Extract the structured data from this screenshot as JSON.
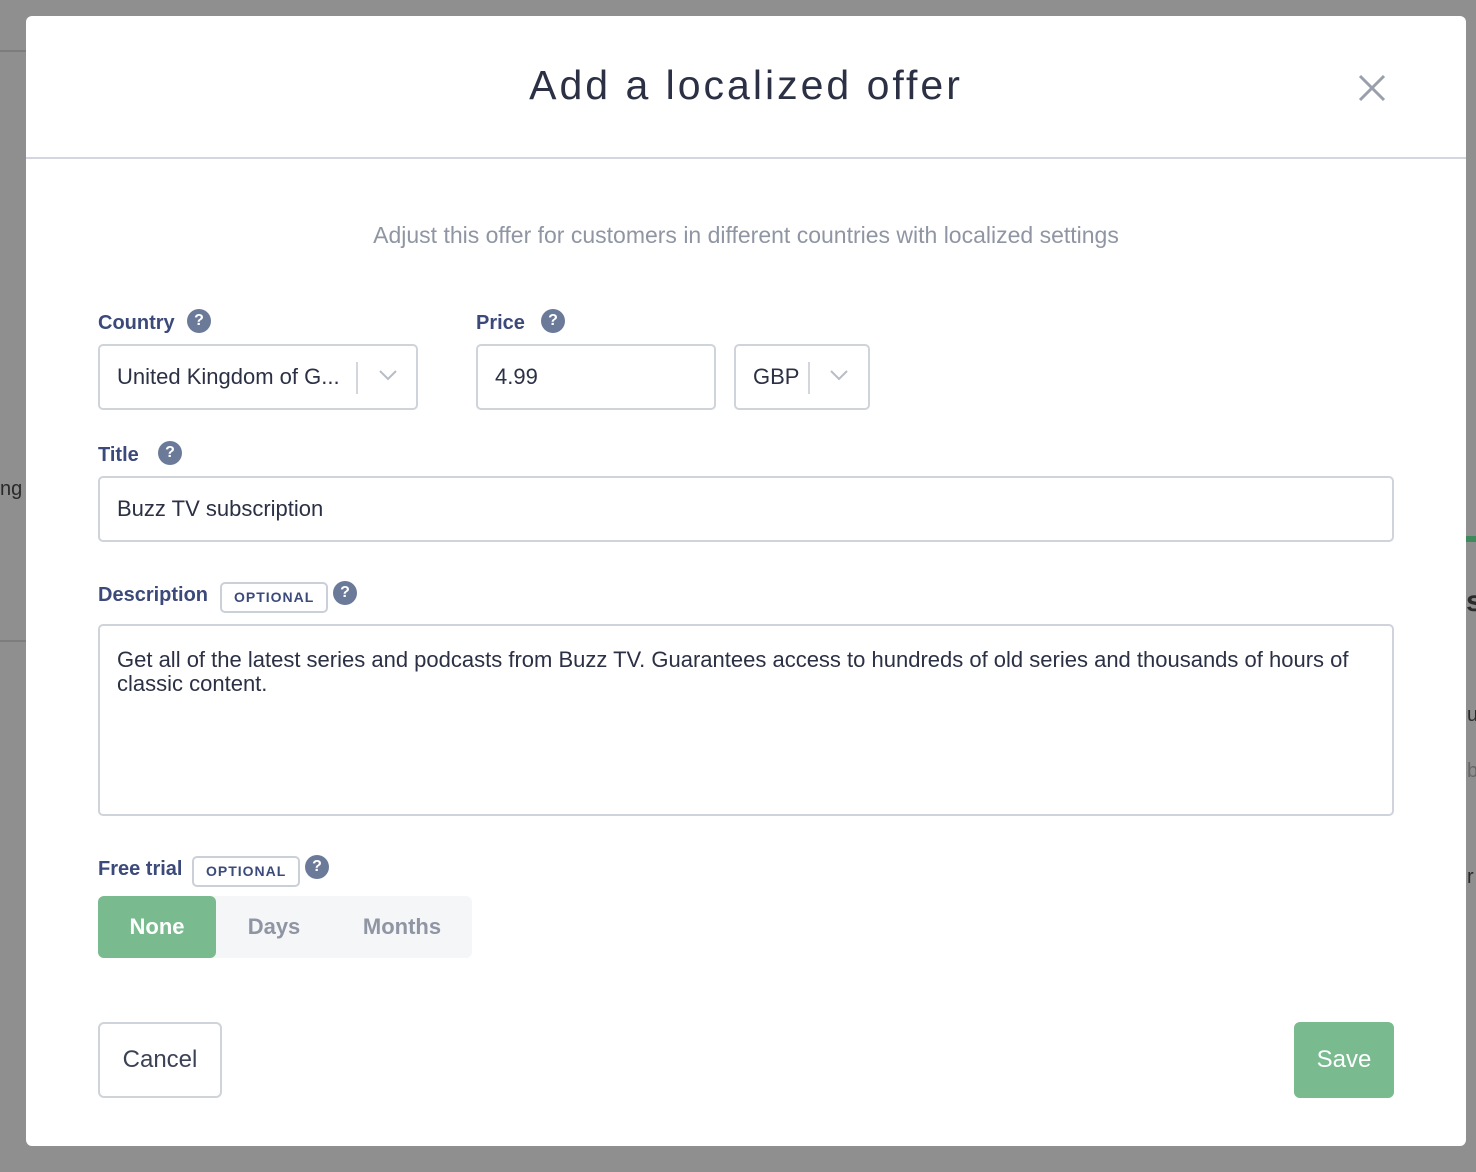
{
  "background": {
    "fragment_left": "ng",
    "fragments_right": [
      "s",
      "u",
      "b",
      "r"
    ]
  },
  "modal": {
    "title": "Add a localized offer",
    "subtitle": "Adjust this offer for customers in different countries with localized settings"
  },
  "form": {
    "country": {
      "label": "Country",
      "value": "United Kingdom of G..."
    },
    "price": {
      "label": "Price",
      "value": "4.99",
      "currency": "GBP"
    },
    "title": {
      "label": "Title",
      "value": "Buzz TV subscription"
    },
    "description": {
      "label": "Description",
      "badge": "OPTIONAL",
      "value": "Get all of the latest series and podcasts from Buzz TV. Guarantees access to hundreds of old series and thousands of hours of classic content."
    },
    "free_trial": {
      "label": "Free trial",
      "badge": "OPTIONAL",
      "options": [
        "None",
        "Days",
        "Months"
      ],
      "selected": "None"
    }
  },
  "actions": {
    "cancel_label": "Cancel",
    "save_label": "Save"
  },
  "colors": {
    "accent_green": "#79ba8f",
    "label_navy": "#3b4a7a",
    "help_icon": "#6c7a99"
  },
  "icons": {
    "close": "close-icon",
    "help": "question-circle-icon",
    "chevron": "chevron-down-icon"
  }
}
